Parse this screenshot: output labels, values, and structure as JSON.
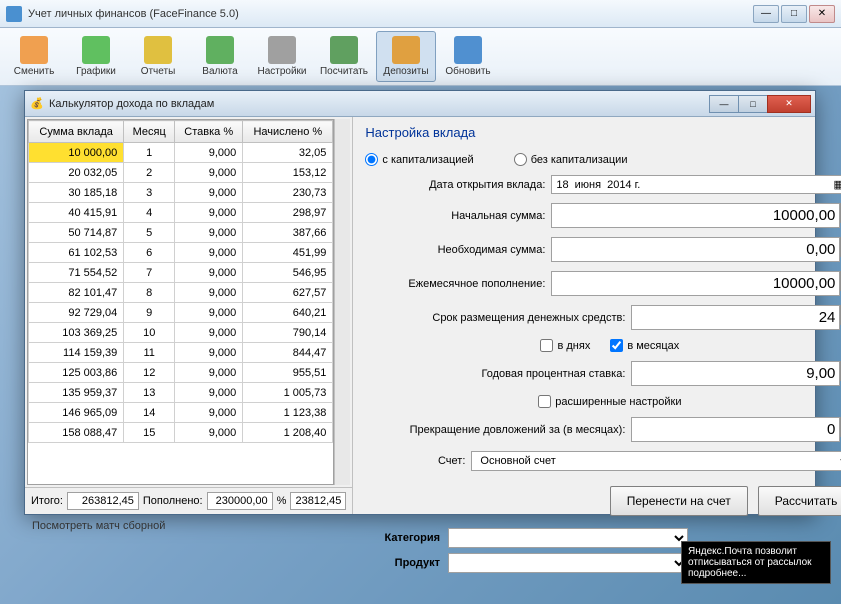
{
  "main": {
    "title": "Учет личных финансов (FaceFinance 5.0)"
  },
  "toolbar": {
    "items": [
      {
        "label": "Сменить",
        "color": "#f0a050"
      },
      {
        "label": "Графики",
        "color": "#60c060"
      },
      {
        "label": "Отчеты",
        "color": "#e0c040"
      },
      {
        "label": "Валюта",
        "color": "#60b060"
      },
      {
        "label": "Настройки",
        "color": "#a0a0a0"
      },
      {
        "label": "Посчитать",
        "color": "#60a060"
      },
      {
        "label": "Депозиты",
        "color": "#e0a040"
      },
      {
        "label": "Обновить",
        "color": "#5090d0"
      }
    ]
  },
  "dialog": {
    "title": "Калькулятор дохода по вкладам"
  },
  "table": {
    "headers": {
      "sum": "Сумма вклада",
      "month": "Месяц",
      "rate": "Ставка %",
      "accrued": "Начислено %"
    },
    "rows": [
      {
        "sum": "10 000,00",
        "month": "1",
        "rate": "9,000",
        "accrued": "32,05"
      },
      {
        "sum": "20 032,05",
        "month": "2",
        "rate": "9,000",
        "accrued": "153,12"
      },
      {
        "sum": "30 185,18",
        "month": "3",
        "rate": "9,000",
        "accrued": "230,73"
      },
      {
        "sum": "40 415,91",
        "month": "4",
        "rate": "9,000",
        "accrued": "298,97"
      },
      {
        "sum": "50 714,87",
        "month": "5",
        "rate": "9,000",
        "accrued": "387,66"
      },
      {
        "sum": "61 102,53",
        "month": "6",
        "rate": "9,000",
        "accrued": "451,99"
      },
      {
        "sum": "71 554,52",
        "month": "7",
        "rate": "9,000",
        "accrued": "546,95"
      },
      {
        "sum": "82 101,47",
        "month": "8",
        "rate": "9,000",
        "accrued": "627,57"
      },
      {
        "sum": "92 729,04",
        "month": "9",
        "rate": "9,000",
        "accrued": "640,21"
      },
      {
        "sum": "103 369,25",
        "month": "10",
        "rate": "9,000",
        "accrued": "790,14"
      },
      {
        "sum": "114 159,39",
        "month": "11",
        "rate": "9,000",
        "accrued": "844,47"
      },
      {
        "sum": "125 003,86",
        "month": "12",
        "rate": "9,000",
        "accrued": "955,51"
      },
      {
        "sum": "135 959,37",
        "month": "13",
        "rate": "9,000",
        "accrued": "1 005,73"
      },
      {
        "sum": "146 965,09",
        "month": "14",
        "rate": "9,000",
        "accrued": "1 123,38"
      },
      {
        "sum": "158 088,47",
        "month": "15",
        "rate": "9,000",
        "accrued": "1 208,40"
      }
    ],
    "totals": {
      "label": "Итого:",
      "sum": "263812,45",
      "topup_label": "Пополнено:",
      "topup": "230000,00",
      "pct_label": "%",
      "pct": "23812,45"
    }
  },
  "settings": {
    "heading": "Настройка вклада",
    "cap_on": "с капитализацией",
    "cap_off": "без капитализации",
    "open_date_label": "Дата открытия вклада:",
    "date": {
      "day": "18",
      "month": "июня",
      "year": "2014 г."
    },
    "start_sum_label": "Начальная сумма:",
    "start_sum": "10000,00",
    "need_sum_label": "Необходимая сумма:",
    "need_sum": "0,00",
    "monthly_label": "Ежемесячное пополнение:",
    "monthly": "10000,00",
    "term_label": "Срок размещения денежных средств:",
    "term": "24",
    "in_days": "в днях",
    "in_months": "в месяцах",
    "rate_label": "Годовая процентная ставка:",
    "rate": "9,00",
    "adv": "расширенные настройки",
    "stop_label": "Прекращение довложений за (в месяцах):",
    "stop": "0",
    "account_label": "Счет:",
    "account": "Основной счет",
    "transfer_btn": "Перенести на счет",
    "calc_btn": "Рассчитать"
  },
  "bottom": {
    "match": "Посмотреть матч сборной",
    "category_label": "Категория",
    "product_label": "Продукт",
    "tooltip": "Яндекс.Почта позволит отписываться от рассылок подробнее..."
  }
}
